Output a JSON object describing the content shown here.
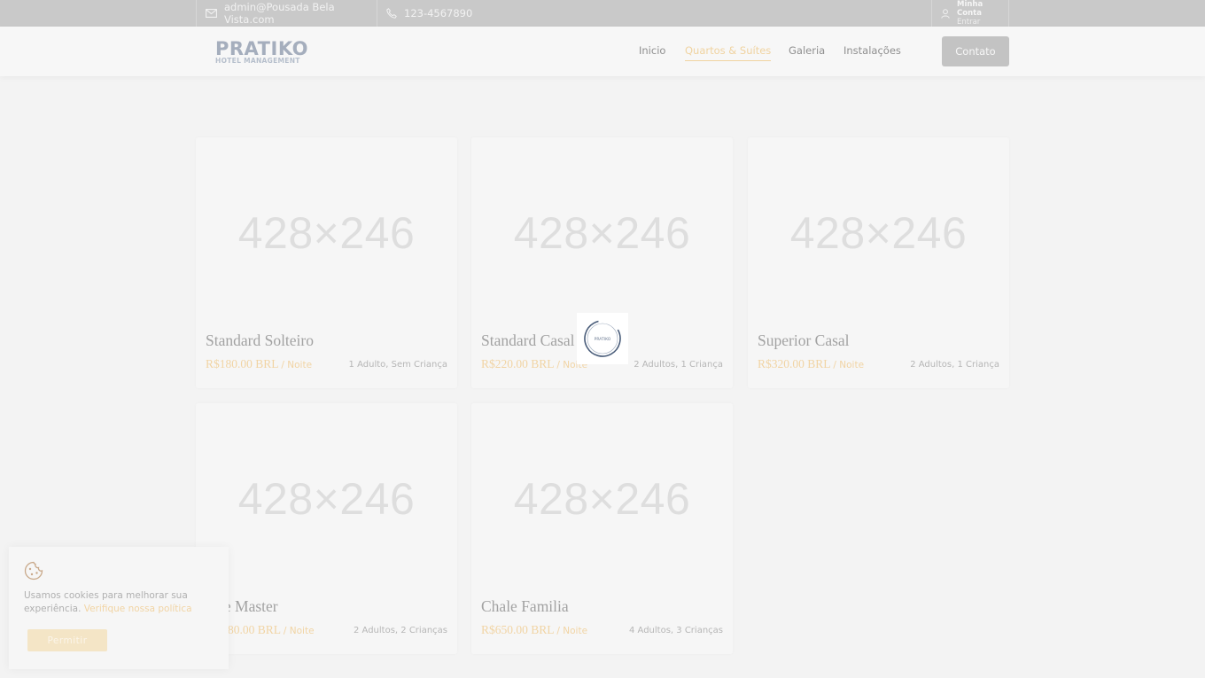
{
  "topbar": {
    "email": "admin@Pousada Bela Vista.com",
    "phone": "123-4567890",
    "account_title": "Minha Conta",
    "account_sub": "Entrar",
    "icons": [
      "mail-icon",
      "phone-icon",
      "user-icon"
    ]
  },
  "header": {
    "logo_main": "PRATIKO",
    "logo_sub": "HOTEL MANAGEMENT",
    "nav": [
      {
        "label": "Inicio",
        "active": false
      },
      {
        "label": "Quartos & Suítes",
        "active": true
      },
      {
        "label": "Galeria",
        "active": false
      },
      {
        "label": "Instalações",
        "active": false
      }
    ],
    "contact_label": "Contato"
  },
  "rooms": [
    {
      "placeholder": "428×246",
      "name": "Standard Solteiro",
      "price": "R$180.00 BRL",
      "per": "/ Noite",
      "capacity": "1 Adulto, Sem Criança"
    },
    {
      "placeholder": "428×246",
      "name": "Standard Casal",
      "price": "R$220.00 BRL",
      "per": "/ Noite",
      "capacity": "2 Adultos, 1 Criança"
    },
    {
      "placeholder": "428×246",
      "name": "Superior Casal",
      "price": "R$320.00 BRL",
      "per": "/ Noite",
      "capacity": "2 Adultos, 1 Criança"
    },
    {
      "placeholder": "428×246",
      "name": "te Master",
      "price": "80.00 BRL",
      "per": "/ Noite",
      "capacity": "2 Adultos, 2 Crianças"
    },
    {
      "placeholder": "428×246",
      "name": "Chale Familia",
      "price": "R$650.00 BRL",
      "per": "/ Noite",
      "capacity": "4 Adultos, 3 Crianças"
    }
  ],
  "loader": {
    "text": "PRATIKO"
  },
  "cookie": {
    "text": "Usamos cookies para melhorar sua experiência.",
    "link": "Verifique nossa política",
    "button": "Permitir"
  },
  "colors": {
    "accent": "#f1d4a4",
    "topbar": "#c9c9c9",
    "background": "#f3f3f3"
  }
}
